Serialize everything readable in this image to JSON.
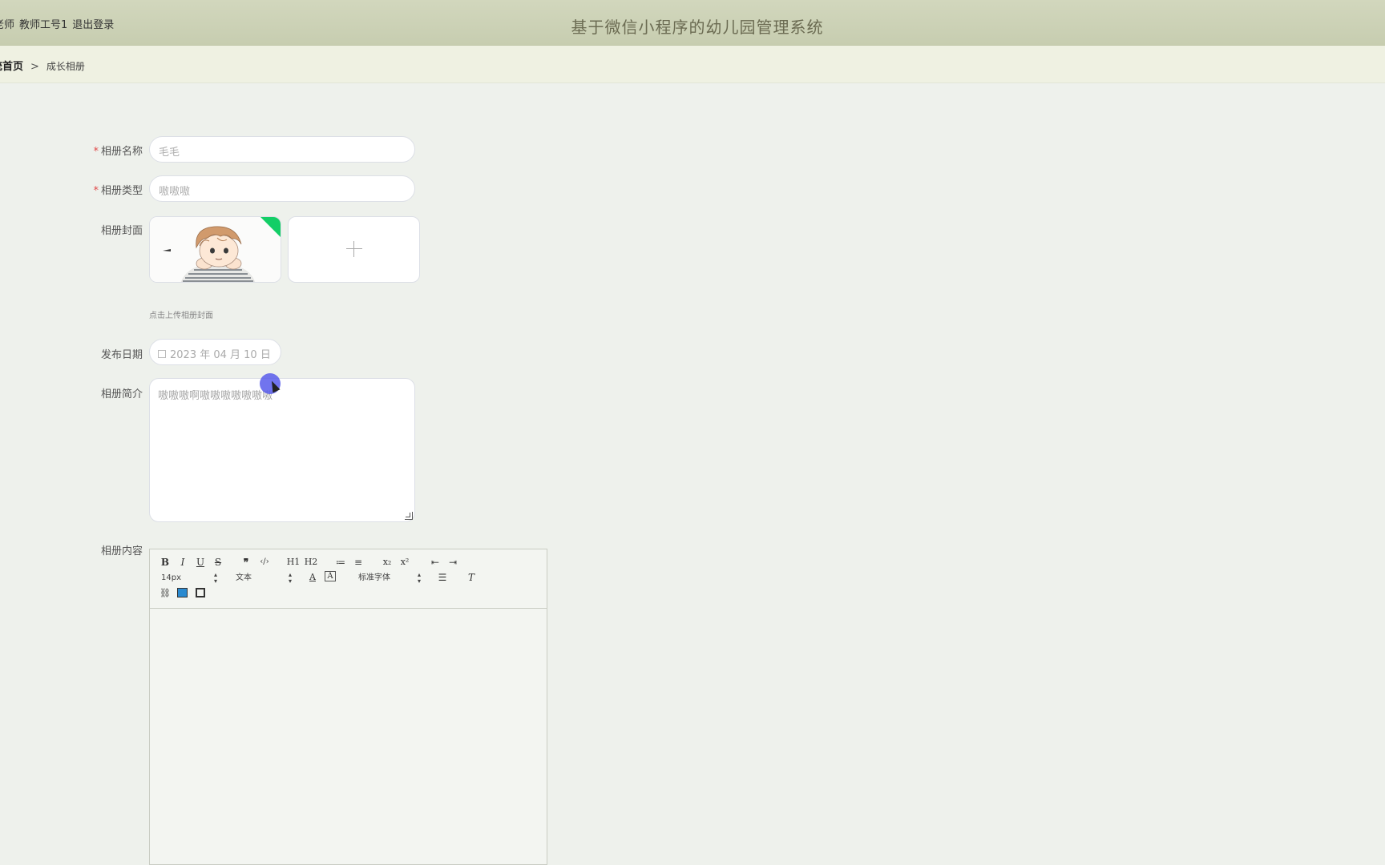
{
  "header": {
    "user_role": "老师",
    "user_id": "教师工号1",
    "logout_label": "退出登录",
    "system_title": "基于微信小程序的幼儿园管理系统"
  },
  "breadcrumb": {
    "home": "统首页",
    "separator": ">",
    "current": "成长相册"
  },
  "form": {
    "album_name": {
      "label": "相册名称",
      "required_mark": "*",
      "value": "毛毛"
    },
    "album_type": {
      "label": "相册类型",
      "required_mark": "*",
      "value": "嗷嗷嗷"
    },
    "album_cover": {
      "label": "相册封面",
      "hint": "点击上传相册封面"
    },
    "publish_date": {
      "label": "发布日期",
      "value": "2023 年 04 月 10 日"
    },
    "album_intro": {
      "label": "相册简介",
      "value": "嗷嗷嗷啊嗷嗷嗷嗷嗷嗷嗷"
    },
    "album_content": {
      "label": "相册内容"
    }
  },
  "editor": {
    "buttons_row1": [
      "B",
      "I",
      "U",
      "S",
      "❞",
      "‹/›",
      "H1",
      "H2",
      "≔",
      "≡",
      "x₂",
      "x²",
      "⇤",
      "⇥"
    ],
    "font_size": "14px",
    "text_format": "文本",
    "font_family": "标准字体",
    "icons": [
      "bold-icon",
      "italic-icon",
      "underline-icon",
      "strike-icon",
      "quote-icon",
      "code-icon",
      "link-icon",
      "image-icon",
      "video-icon",
      "clear-format-icon"
    ]
  },
  "colors": {
    "topbar": "#c9cfb2",
    "title": "#6b6b52",
    "required": "#e04a4a",
    "upload_success": "#13ce66",
    "cursor": "#585ceb"
  }
}
